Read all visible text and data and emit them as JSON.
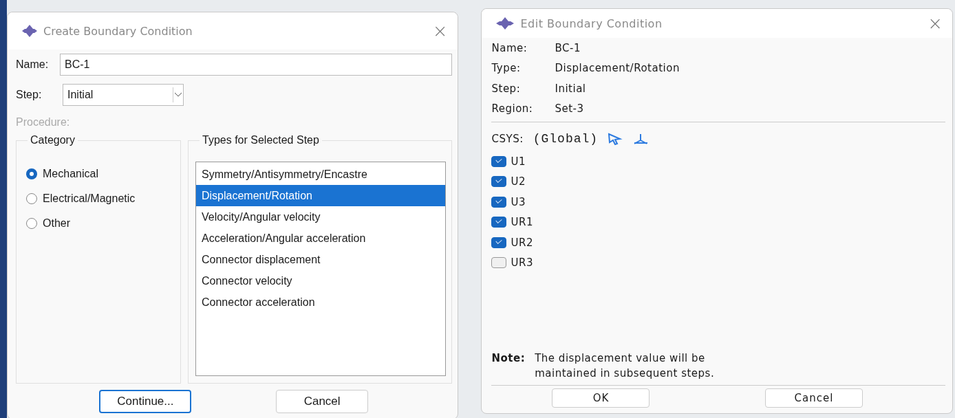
{
  "create_dialog": {
    "title": "Create Boundary Condition",
    "close": "×",
    "name_label": "Name:",
    "name_value": "BC-1",
    "step_label": "Step:",
    "step_value": "Initial",
    "procedure_label": "Procedure:",
    "category": {
      "title": "Category",
      "options": [
        {
          "label": "Mechanical",
          "selected": true
        },
        {
          "label": "Electrical/Magnetic",
          "selected": false
        },
        {
          "label": "Other",
          "selected": false
        }
      ]
    },
    "types": {
      "title": "Types for Selected Step",
      "items": [
        {
          "label": "Symmetry/Antisymmetry/Encastre",
          "selected": false
        },
        {
          "label": "Displacement/Rotation",
          "selected": true
        },
        {
          "label": "Velocity/Angular velocity",
          "selected": false
        },
        {
          "label": "Acceleration/Angular acceleration",
          "selected": false
        },
        {
          "label": "Connector displacement",
          "selected": false
        },
        {
          "label": "Connector velocity",
          "selected": false
        },
        {
          "label": "Connector acceleration",
          "selected": false
        }
      ]
    },
    "buttons": [
      "Continue...",
      "Cancel"
    ]
  },
  "edit_dialog": {
    "title": "Edit Boundary Condition",
    "close": "×",
    "fields": [
      {
        "label": "Name:",
        "value": "BC-1"
      },
      {
        "label": "Type:",
        "value": "Displacement/Rotation"
      },
      {
        "label": "Step:",
        "value": "Initial"
      },
      {
        "label": "Region:",
        "value": "Set-3"
      }
    ],
    "csys_label": "CSYS:",
    "csys_value": "(Global)",
    "dofs": [
      {
        "label": "U1",
        "checked": true
      },
      {
        "label": "U2",
        "checked": true
      },
      {
        "label": "U3",
        "checked": true
      },
      {
        "label": "UR1",
        "checked": true
      },
      {
        "label": "UR2",
        "checked": true
      },
      {
        "label": "UR3",
        "checked": false
      }
    ],
    "note_label": "Note:",
    "note_text": "The displacement value will be maintained in subsequent steps.",
    "buttons": [
      "OK",
      "Cancel"
    ]
  }
}
